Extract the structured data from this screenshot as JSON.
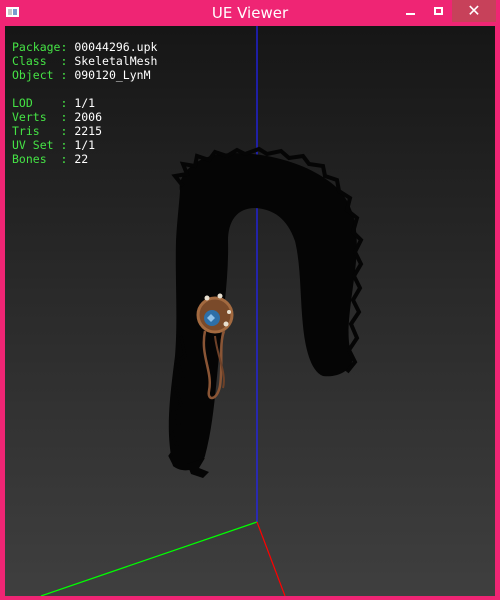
{
  "window": {
    "title": "UE Viewer",
    "close_symbol": "✕"
  },
  "info": {
    "package_key": "Package:",
    "package_val": "00044296.upk",
    "class_key": "Class  :",
    "class_val": "SkeletalMesh",
    "object_key": "Object :",
    "object_val": "090120_LynM",
    "lod_key": "LOD    :",
    "lod_val": "1/1",
    "verts_key": "Verts  :",
    "verts_val": "2006",
    "tris_key": "Tris   :",
    "tris_val": "2215",
    "uvset_key": "UV Set :",
    "uvset_val": "1/1",
    "bones_key": "Bones  :",
    "bones_val": "22"
  },
  "colors": {
    "frame": "#ef2574",
    "info_key": "#45e345",
    "info_value": "#ffffff",
    "axis_x": "#ff0000",
    "axis_y": "#00ff00",
    "axis_z": "#2222ff"
  }
}
